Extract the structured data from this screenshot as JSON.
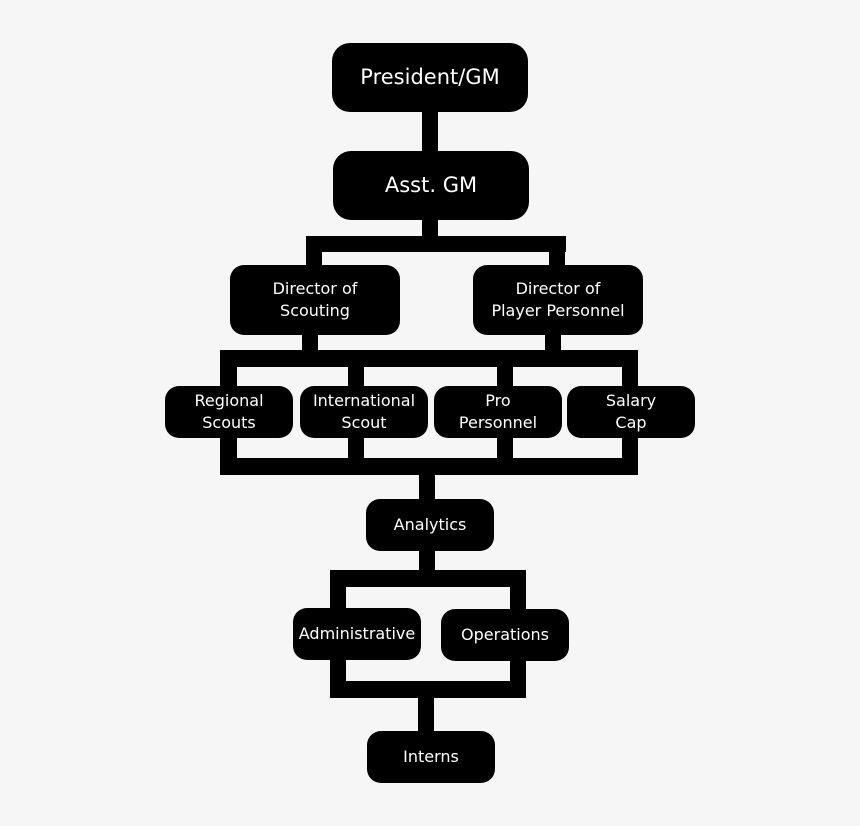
{
  "chart_data": {
    "type": "org-chart",
    "title": "",
    "nodes": [
      {
        "id": "president",
        "label": "President/GM"
      },
      {
        "id": "asst_gm",
        "label": "Asst. GM",
        "parent": "president"
      },
      {
        "id": "dir_scouting",
        "label": "Director of\nScouting",
        "parent": "asst_gm"
      },
      {
        "id": "dir_personnel",
        "label": "Director of\nPlayer Personnel",
        "parent": "asst_gm"
      },
      {
        "id": "regional",
        "label": "Regional\nScouts",
        "parent": "dir_scouting"
      },
      {
        "id": "international",
        "label": "International\nScout",
        "parent": "dir_scouting"
      },
      {
        "id": "pro",
        "label": "Pro\nPersonnel",
        "parent": "dir_personnel"
      },
      {
        "id": "salary",
        "label": "Salary\nCap",
        "parent": "dir_personnel"
      },
      {
        "id": "analytics",
        "label": "Analytics",
        "parent": "row4"
      },
      {
        "id": "administrative",
        "label": "Administrative",
        "parent": "analytics"
      },
      {
        "id": "operations",
        "label": "Operations",
        "parent": "analytics"
      },
      {
        "id": "interns",
        "label": "Interns",
        "parent": "row6"
      }
    ]
  },
  "nodes": {
    "president": "President/GM",
    "asst_gm": "Asst. GM",
    "dir_scouting": "Director of\nScouting",
    "dir_personnel": "Director of\nPlayer Personnel",
    "regional": "Regional\nScouts",
    "international": "International\nScout",
    "pro": "Pro\nPersonnel",
    "salary": "Salary\nCap",
    "analytics": "Analytics",
    "administrative": "Administrative",
    "operations": "Operations",
    "interns": "Interns"
  },
  "colors": {
    "background": "#f6f6f6",
    "box": "#000000",
    "text": "#ffffff",
    "connector": "#000000"
  }
}
